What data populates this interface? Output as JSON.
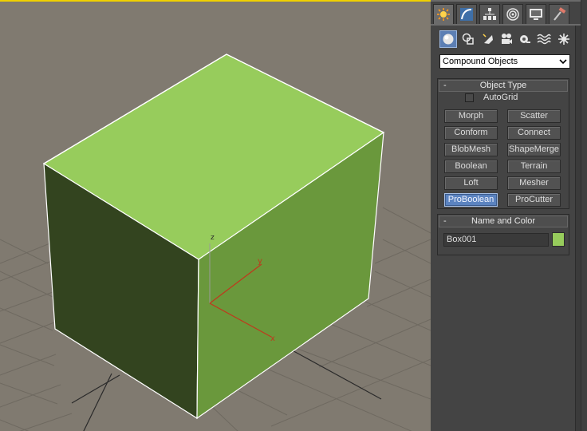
{
  "viewport": {
    "background": "#807a70",
    "box_colors": {
      "top": "#97cc5c",
      "front": "#33441f",
      "side": "#6a983c"
    },
    "gizmo": {
      "z_label": "z",
      "y_label": "y",
      "x_label": "x"
    }
  },
  "command_panel": {
    "tabs": [
      {
        "name": "create-tab",
        "icon": "sun-icon",
        "active": true
      },
      {
        "name": "modify-tab",
        "icon": "curve-icon",
        "active": false
      },
      {
        "name": "hierarchy-tab",
        "icon": "hierarchy-icon",
        "active": false
      },
      {
        "name": "motion-tab",
        "icon": "motion-icon",
        "active": false
      },
      {
        "name": "display-tab",
        "icon": "monitor-icon",
        "active": false
      },
      {
        "name": "utilities-tab",
        "icon": "hammer-icon",
        "active": false
      }
    ],
    "subcategories": [
      {
        "name": "geometry",
        "icon": "sphere-icon",
        "active": true
      },
      {
        "name": "shapes",
        "icon": "shapes-icon",
        "active": false
      },
      {
        "name": "lights",
        "icon": "light-icon",
        "active": false
      },
      {
        "name": "cameras",
        "icon": "camera-icon",
        "active": false
      },
      {
        "name": "helpers",
        "icon": "tape-icon",
        "active": false
      },
      {
        "name": "space-warps",
        "icon": "waves-icon",
        "active": false
      },
      {
        "name": "systems",
        "icon": "gear-icon",
        "active": false
      }
    ],
    "category_dropdown": {
      "value": "Compound Objects"
    },
    "object_type": {
      "title": "Object Type",
      "collapse_label": "-",
      "autogrid_label": "AutoGrid",
      "buttons": [
        {
          "label": "Morph",
          "active": false
        },
        {
          "label": "Scatter",
          "active": false
        },
        {
          "label": "Conform",
          "active": false
        },
        {
          "label": "Connect",
          "active": false
        },
        {
          "label": "BlobMesh",
          "active": false
        },
        {
          "label": "ShapeMerge",
          "active": false
        },
        {
          "label": "Boolean",
          "active": false
        },
        {
          "label": "Terrain",
          "active": false
        },
        {
          "label": "Loft",
          "active": false
        },
        {
          "label": "Mesher",
          "active": false
        },
        {
          "label": "ProBoolean",
          "active": true
        },
        {
          "label": "ProCutter",
          "active": false
        }
      ]
    },
    "name_and_color": {
      "title": "Name and Color",
      "collapse_label": "-",
      "object_name": "Box001",
      "color": "#97cc5c"
    }
  }
}
